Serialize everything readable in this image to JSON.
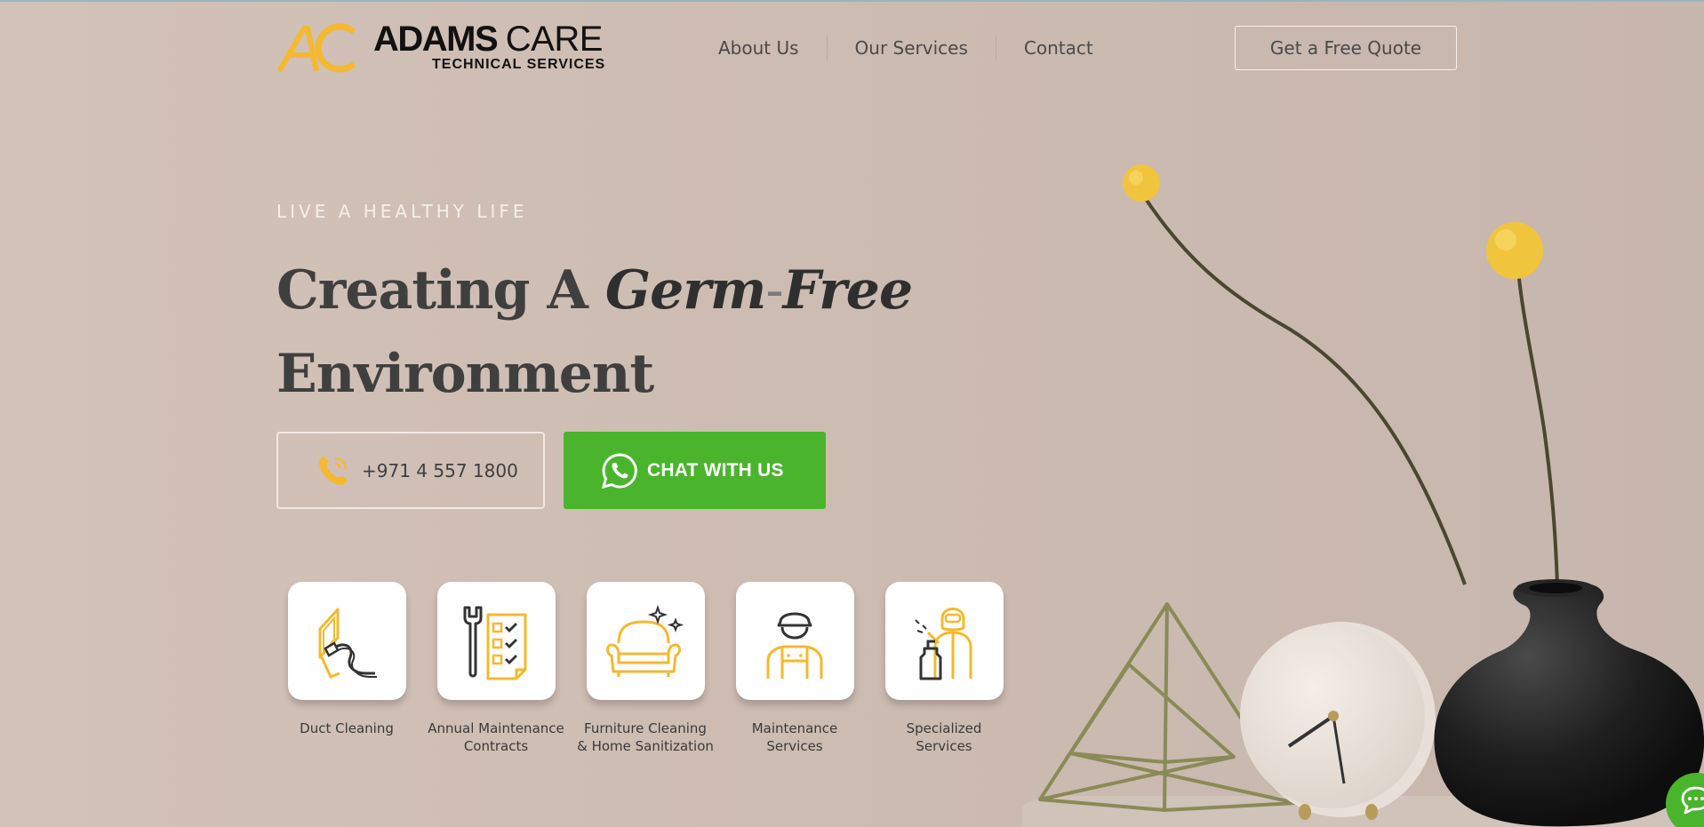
{
  "brand": {
    "mark": "AC",
    "title_bold": "ADAMS",
    "title_light": "CARE",
    "subtitle": "TECHNICAL SERVICES",
    "colors": {
      "accent": "#f5b82e",
      "dark": "#111111"
    }
  },
  "nav": {
    "items": [
      "About Us",
      "Our Services",
      "Contact"
    ]
  },
  "header": {
    "quote_label": "Get a Free Quote"
  },
  "hero": {
    "eyebrow": "LIVE A HEALTHY LIFE",
    "headline_part1": "Creating A ",
    "headline_em1": "Germ",
    "headline_dash": "-",
    "headline_em2": "Free",
    "headline_part2": "Environment",
    "phone": "+971 4 557 1800",
    "phone_icon": "phone-icon",
    "chat_label": "CHAT WITH US",
    "chat_icon": "whatsapp-icon",
    "chat_color": "#4ab52c"
  },
  "services": [
    {
      "label_line1": "Duct Cleaning",
      "label_line2": "",
      "icon": "duct-cleaning-icon"
    },
    {
      "label_line1": "Annual Maintenance",
      "label_line2": "Contracts",
      "icon": "wrench-checklist-icon"
    },
    {
      "label_line1": "Furniture Cleaning",
      "label_line2": "& Home Sanitization",
      "icon": "sofa-sparkle-icon"
    },
    {
      "label_line1": "Maintenance",
      "label_line2": "Services",
      "icon": "technician-icon"
    },
    {
      "label_line1": "Specialized",
      "label_line2": "Services",
      "icon": "sanitizer-worker-icon"
    }
  ],
  "floating_chat_icon": "chat-bubble-icon"
}
